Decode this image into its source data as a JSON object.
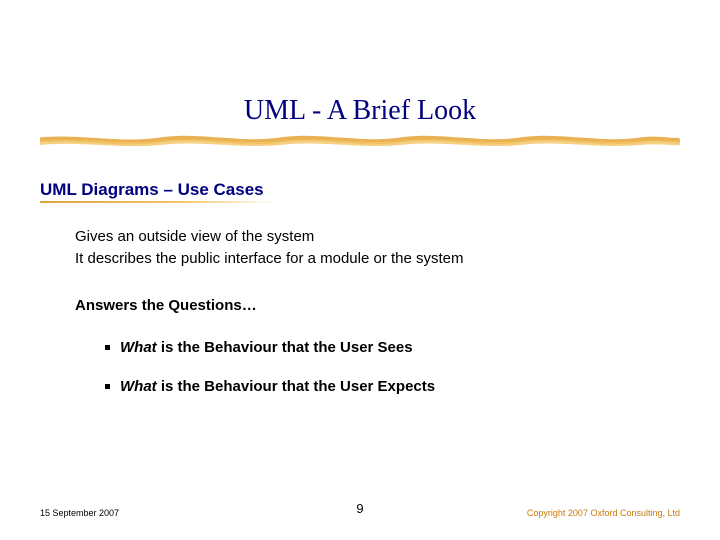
{
  "title": "UML - A Brief Look",
  "subhead": "UML Diagrams – Use Cases",
  "body": {
    "line1": "Gives an outside view of the system",
    "line2": "It describes the public interface for a module or the system",
    "questions_head": "Answers the Questions…",
    "bullets": [
      {
        "em": "What",
        "rest": " is the Behaviour that the User Sees"
      },
      {
        "em": "What",
        "rest": " is the Behaviour that the User Expects"
      }
    ]
  },
  "footer": {
    "date": "15 September 2007",
    "page": "9",
    "copyright": "Copyright 2007 Oxford Consulting, Ltd"
  }
}
